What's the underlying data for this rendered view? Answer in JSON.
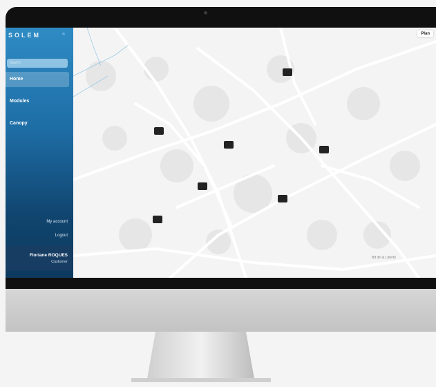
{
  "sidebar": {
    "logo": "SOLEM",
    "search_placeholder": "Search",
    "items": [
      {
        "label": "Home",
        "active": true
      },
      {
        "label": "Modules",
        "active": false
      },
      {
        "label": "Canopy",
        "active": false
      }
    ],
    "my_account": "My account",
    "logout": "Logout",
    "user_name": "Floriane ROQUES",
    "user_role": "Customer"
  },
  "map": {
    "view_label": "Plan",
    "street_label": "Bd de la Liberté",
    "module_count": 7
  },
  "colors": {
    "sidebar_top": "#2f8bc4",
    "sidebar_bottom": "#0d3a5e",
    "marker": "#222222"
  }
}
